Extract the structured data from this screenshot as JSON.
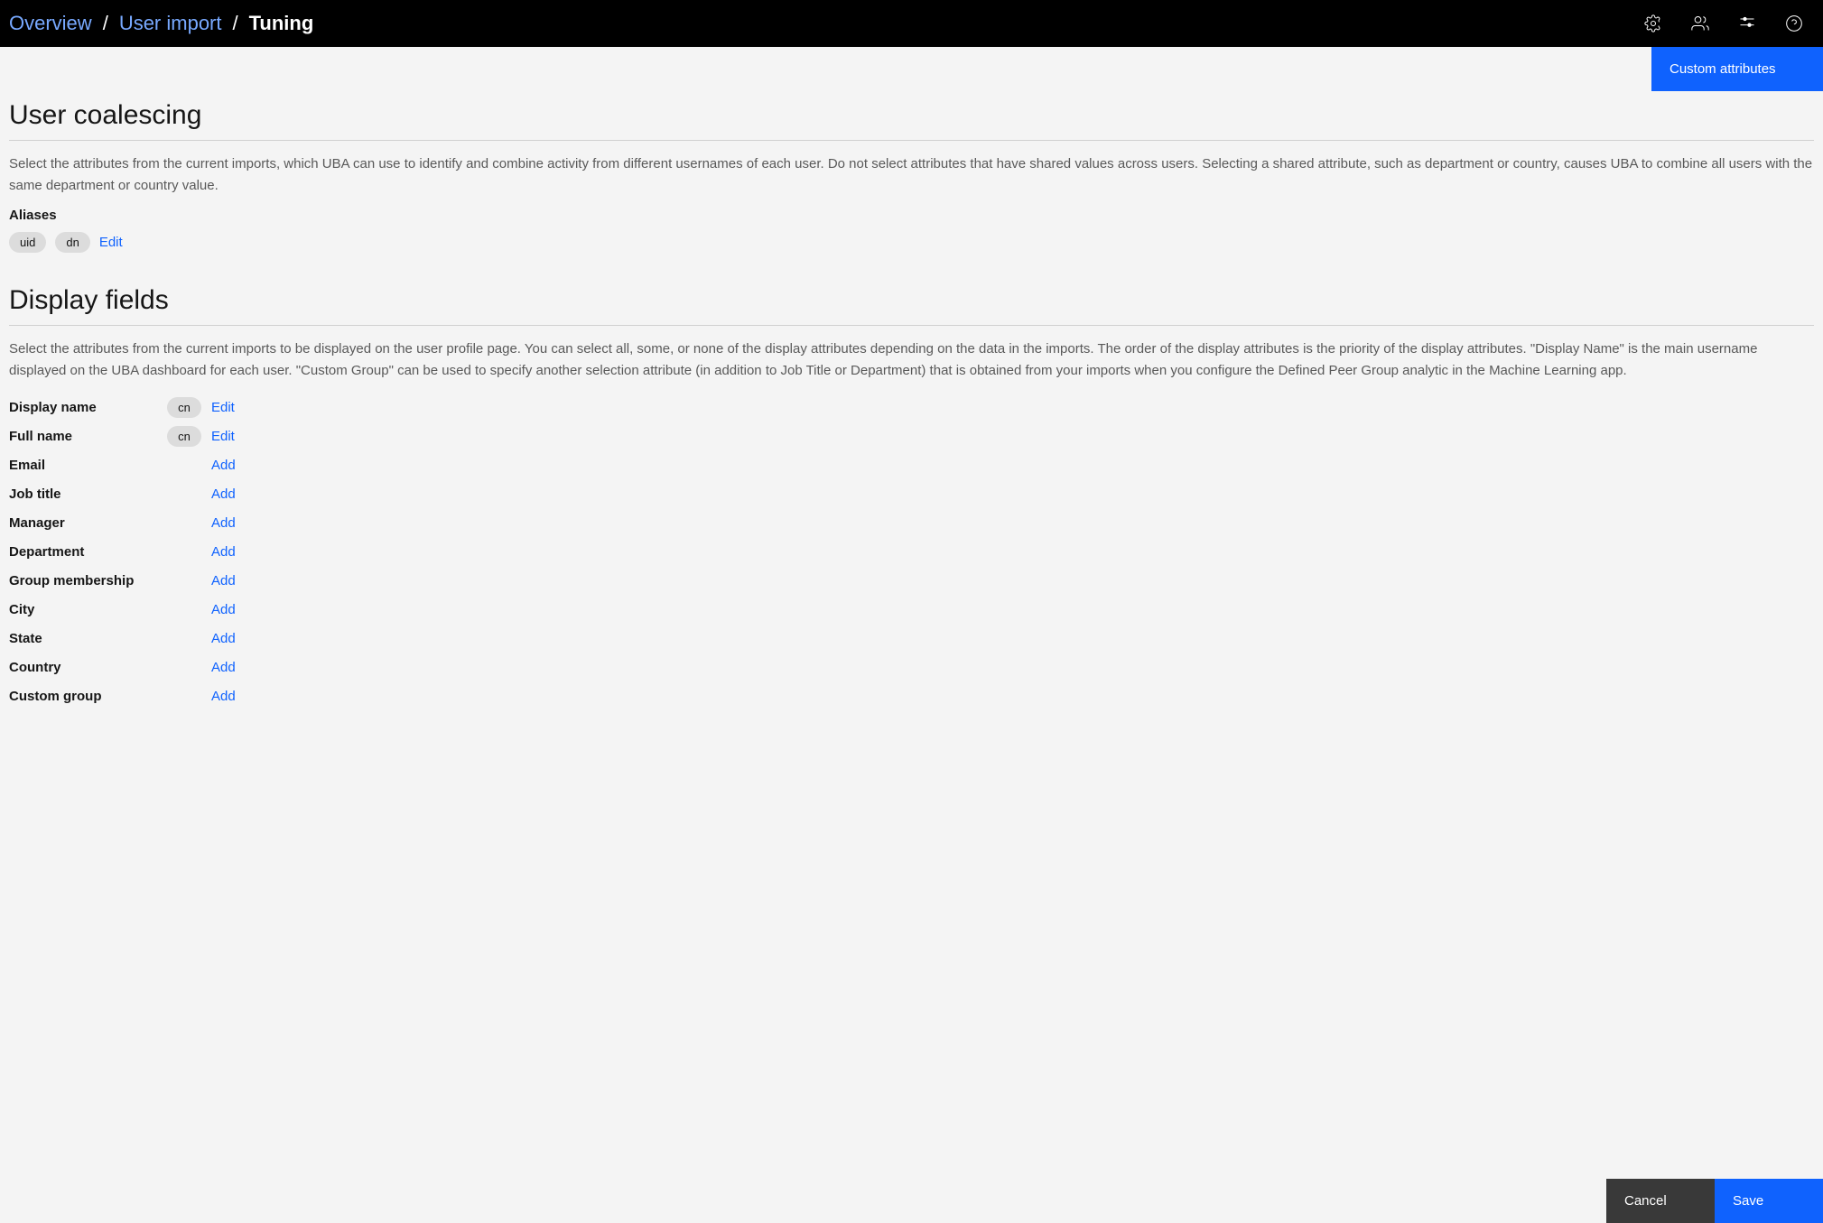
{
  "breadcrumb": {
    "overview": "Overview",
    "user_import": "User import",
    "current": "Tuning"
  },
  "buttons": {
    "custom_attributes": "Custom attributes",
    "cancel": "Cancel",
    "save": "Save"
  },
  "coalescing": {
    "heading": "User coalescing",
    "desc": "Select the attributes from the current imports, which UBA can use to identify and combine activity from different usernames of each user. Do not select attributes that have shared values across users. Selecting a shared attribute, such as department or country, causes UBA to combine all users with the same department or country value.",
    "aliases_label": "Aliases",
    "aliases": [
      "uid",
      "dn"
    ],
    "edit": "Edit"
  },
  "display": {
    "heading": "Display fields",
    "desc": "Select the attributes from the current imports to be displayed on the user profile page. You can select all, some, or none of the display attributes depending on the data in the imports. The order of the display attributes is the priority of the display attributes. \"Display Name\" is the main username displayed on the UBA dashboard for each user. \"Custom Group\" can be used to specify another selection attribute (in addition to Job Title or Department) that is obtained from your imports when you configure the Defined Peer Group analytic in the Machine Learning app.",
    "fields": [
      {
        "label": "Display name",
        "chip": "cn",
        "action": "Edit"
      },
      {
        "label": "Full name",
        "chip": "cn",
        "action": "Edit"
      },
      {
        "label": "Email",
        "chip": "",
        "action": "Add"
      },
      {
        "label": "Job title",
        "chip": "",
        "action": "Add"
      },
      {
        "label": "Manager",
        "chip": "",
        "action": "Add"
      },
      {
        "label": "Department",
        "chip": "",
        "action": "Add"
      },
      {
        "label": "Group membership",
        "chip": "",
        "action": "Add"
      },
      {
        "label": "City",
        "chip": "",
        "action": "Add"
      },
      {
        "label": "State",
        "chip": "",
        "action": "Add"
      },
      {
        "label": "Country",
        "chip": "",
        "action": "Add"
      },
      {
        "label": "Custom group",
        "chip": "",
        "action": "Add"
      }
    ]
  }
}
